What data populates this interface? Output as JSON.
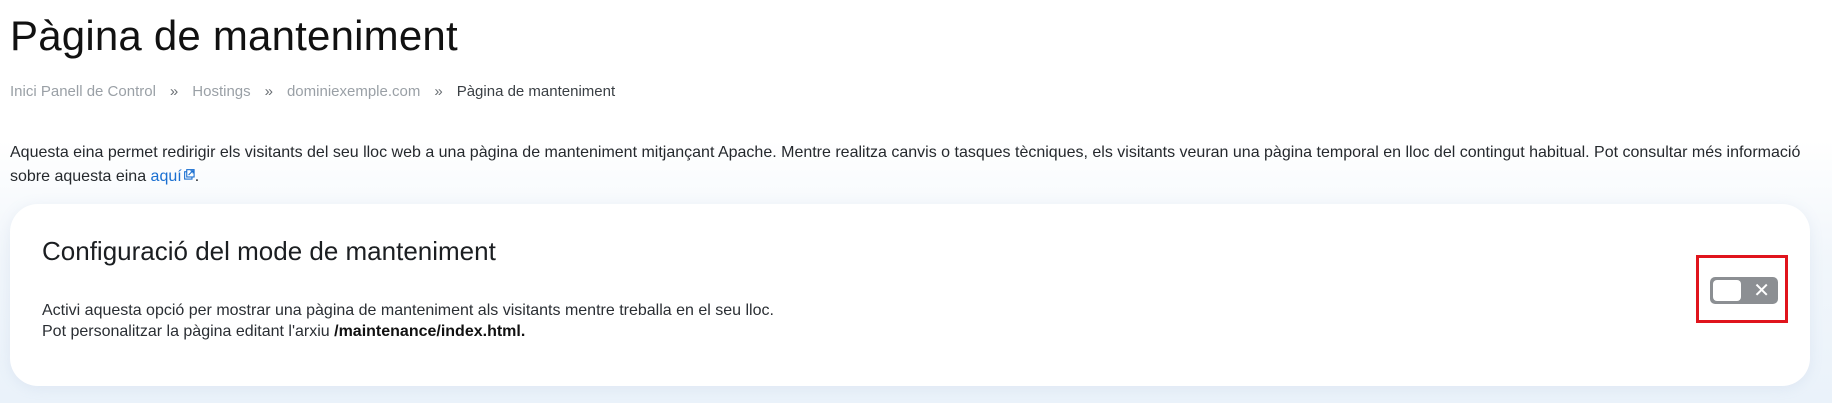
{
  "page": {
    "title": "Pàgina de manteniment"
  },
  "breadcrumb": {
    "items": [
      {
        "label": "Inici Panell de Control"
      },
      {
        "label": "Hostings"
      },
      {
        "label": "dominiexemple.com"
      },
      {
        "label": "Pàgina de manteniment"
      }
    ],
    "separator": "»"
  },
  "intro": {
    "text": "Aquesta eina permet redirigir els visitants del seu lloc web a una pàgina de manteniment mitjançant Apache. Mentre realitza canvis o tasques tècniques, els visitants veuran una pàgina temporal en lloc del contingut habitual. Pot consultar més informació sobre aquesta eina ",
    "link_label": "aquí",
    "trailing": "."
  },
  "card": {
    "title": "Configuració del mode de manteniment",
    "line1": "Activi aquesta opció per mostrar una pàgina de manteniment als visitants mentre treballa en el seu lloc.",
    "line2_prefix": "Pot personalitzar la pàgina editant l'arxiu ",
    "line2_file": "/maintenance/index.html."
  },
  "toggle": {
    "state": "off",
    "off_symbol": "✕",
    "icon": "toggle-off-icon"
  },
  "colors": {
    "link": "#1a6fd1",
    "highlight": "#e0141c",
    "toggle_off": "#8c8f93"
  }
}
